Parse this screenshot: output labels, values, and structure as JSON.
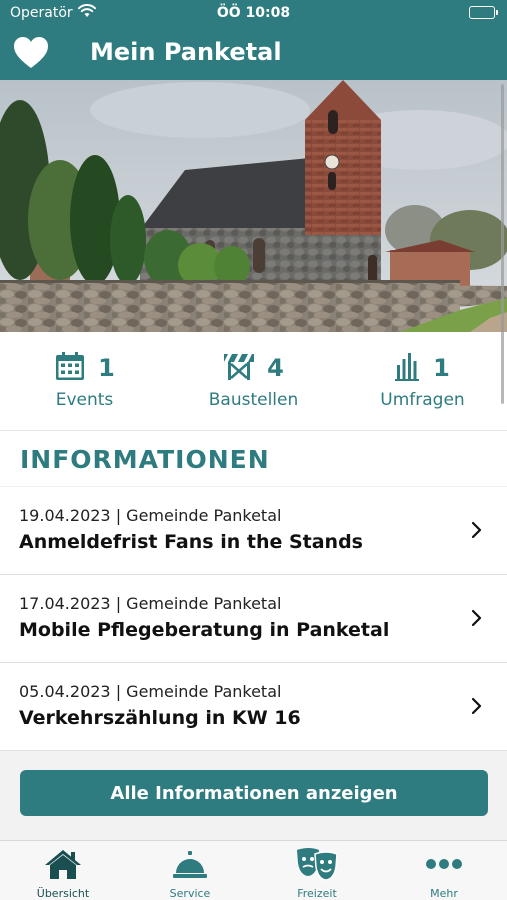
{
  "status_bar": {
    "carrier": "Operatör",
    "time": "ÖÖ 10:08"
  },
  "header": {
    "title": "Mein Panketal",
    "icon": "heart-icon"
  },
  "stats": [
    {
      "icon": "calendar-icon",
      "count": "1",
      "label": "Events"
    },
    {
      "icon": "construction-icon",
      "count": "4",
      "label": "Baustellen"
    },
    {
      "icon": "bar-chart-icon",
      "count": "1",
      "label": "Umfragen"
    }
  ],
  "info_section": {
    "title": "INFORMATIONEN",
    "items": [
      {
        "meta": "19.04.2023 | Gemeinde Panketal",
        "headline": "Anmeldefrist Fans in the Stands"
      },
      {
        "meta": "17.04.2023 | Gemeinde Panketal",
        "headline": "Mobile Pflegeberatung in Panketal"
      },
      {
        "meta": "05.04.2023 | Gemeinde Panketal",
        "headline": "Verkehrszählung in KW 16"
      }
    ],
    "all_button": "Alle Informationen anzeigen"
  },
  "tab_bar": [
    {
      "icon": "home-icon",
      "label": "Übersicht",
      "active": true
    },
    {
      "icon": "service-bell-icon",
      "label": "Service",
      "active": false
    },
    {
      "icon": "theater-masks-icon",
      "label": "Freizeit",
      "active": false
    },
    {
      "icon": "more-dots-icon",
      "label": "Mehr",
      "active": false
    }
  ],
  "colors": {
    "primary": "#2e7b80",
    "primary_dark": "#1a4f52",
    "background": "#f2f2f2"
  }
}
